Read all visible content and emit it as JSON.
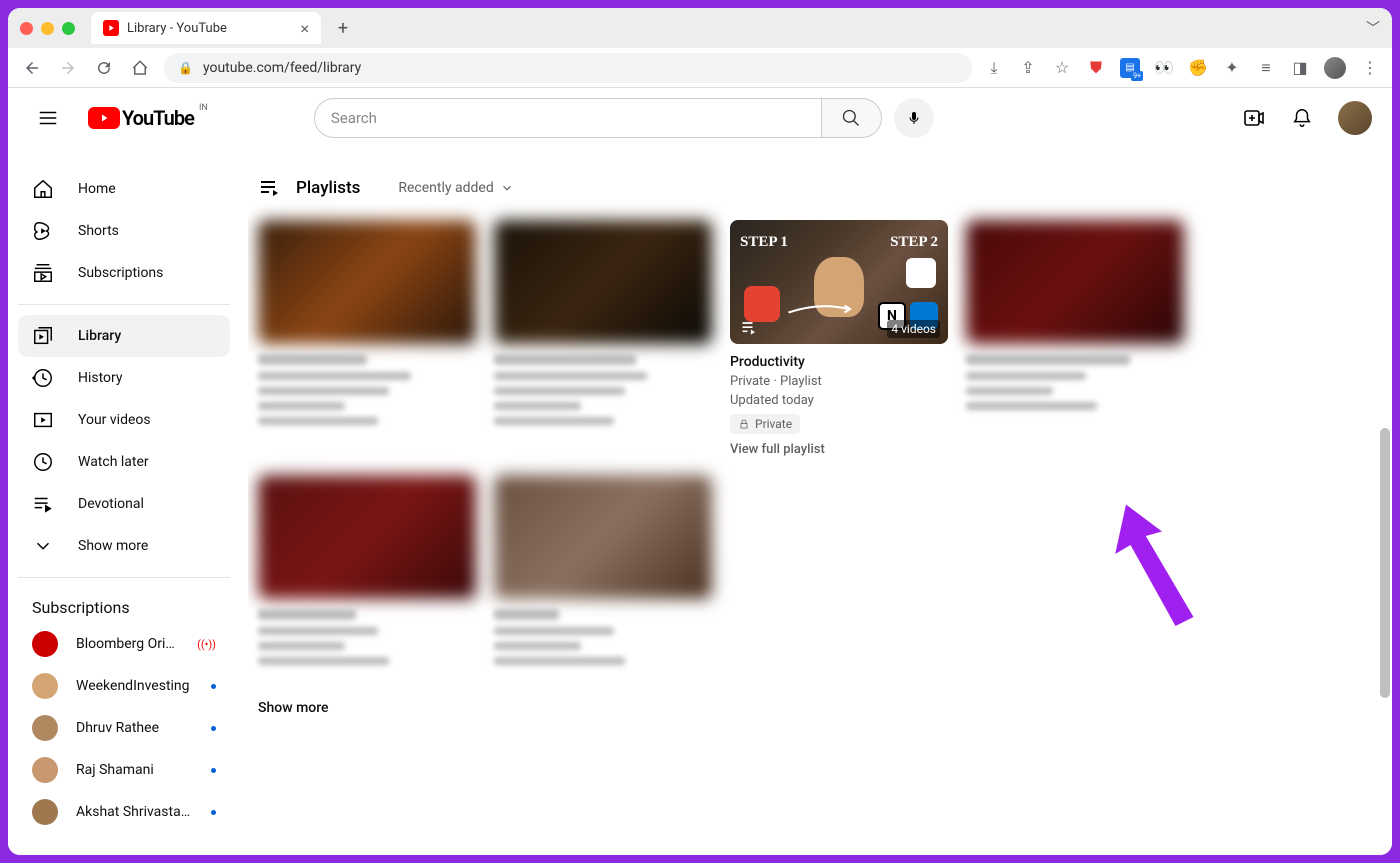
{
  "browser": {
    "tab_title": "Library - YouTube",
    "url": "youtube.com/feed/library"
  },
  "header": {
    "logo_text": "YouTube",
    "logo_region": "IN",
    "search_placeholder": "Search"
  },
  "sidebar": {
    "nav1": [
      {
        "label": "Home"
      },
      {
        "label": "Shorts"
      },
      {
        "label": "Subscriptions"
      }
    ],
    "nav2": [
      {
        "label": "Library"
      },
      {
        "label": "History"
      },
      {
        "label": "Your videos"
      },
      {
        "label": "Watch later"
      },
      {
        "label": "Devotional"
      },
      {
        "label": "Show more"
      }
    ],
    "subs_header": "Subscriptions",
    "subs": [
      {
        "name": "Bloomberg Origi…",
        "status": "live"
      },
      {
        "name": "WeekendInvesting",
        "status": "dot"
      },
      {
        "name": "Dhruv Rathee",
        "status": "dot"
      },
      {
        "name": "Raj Shamani",
        "status": "dot"
      },
      {
        "name": "Akshat Shrivasta…",
        "status": "dot"
      }
    ]
  },
  "main": {
    "section_title": "Playlists",
    "sort_label": "Recently added",
    "playlist": {
      "title": "Productivity",
      "subtitle": "Private · Playlist",
      "updated": "Updated today",
      "badge": "Private",
      "view_link": "View full playlist",
      "video_count": "4 videos",
      "notion_letter": "N"
    },
    "show_more": "Show more"
  }
}
